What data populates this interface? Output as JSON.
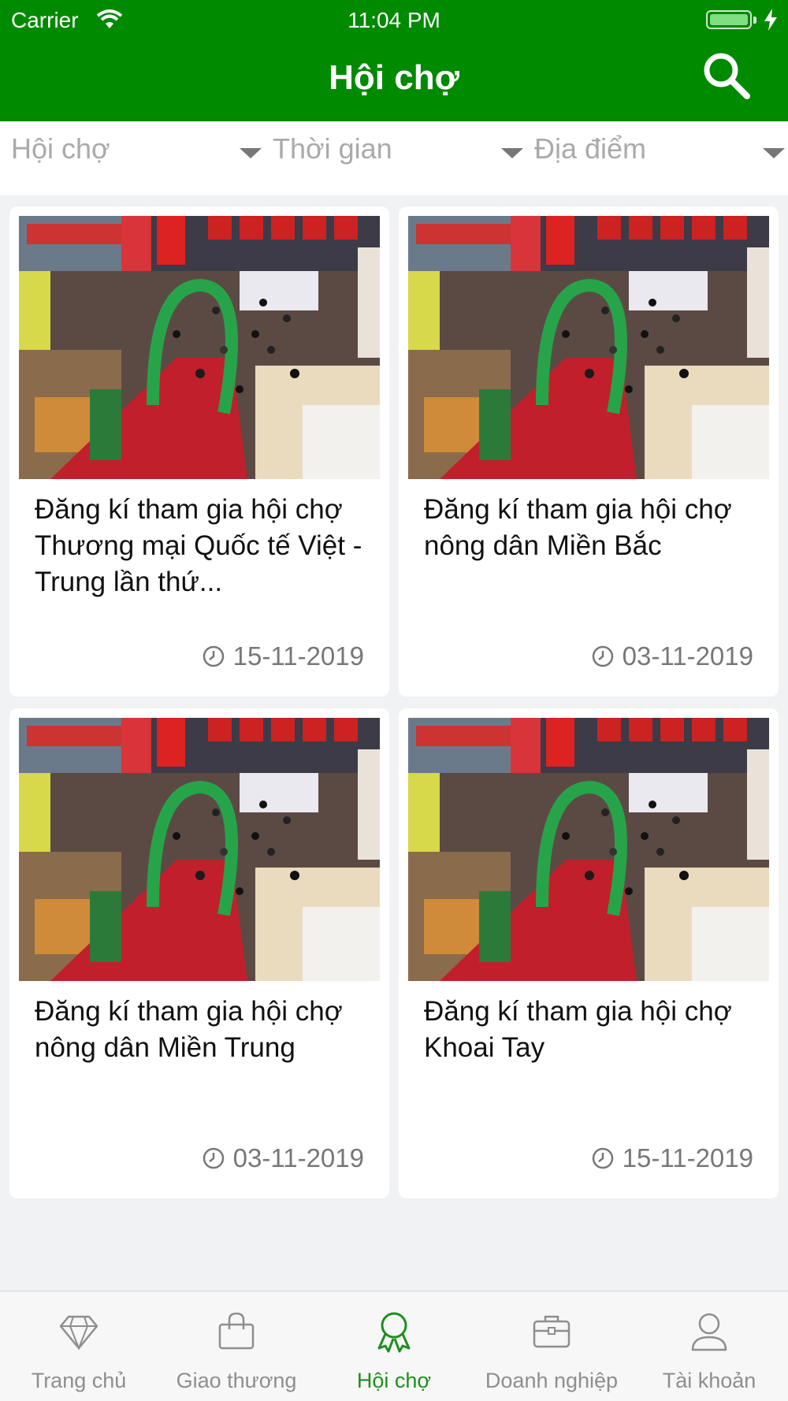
{
  "status_bar": {
    "carrier": "Carrier",
    "time": "11:04 PM"
  },
  "header": {
    "title": "Hội chợ"
  },
  "filters": [
    {
      "label": "Hội chợ"
    },
    {
      "label": "Thời gian"
    },
    {
      "label": "Địa điểm"
    }
  ],
  "events": [
    {
      "title": "Đăng kí tham gia hội chợ Thương mại Quốc tế Việt - Trung lần thứ...",
      "date": "15-11-2019"
    },
    {
      "title": "Đăng kí tham gia hội chợ nông dân Miền Bắc",
      "date": "03-11-2019"
    },
    {
      "title": "Đăng kí tham gia hội chợ nông dân Miền Trung",
      "date": "03-11-2019"
    },
    {
      "title": "Đăng kí tham gia hội chợ Khoai Tay",
      "date": "15-11-2019"
    }
  ],
  "tabs": [
    {
      "label": "Trang chủ",
      "icon": "diamond-icon",
      "active": false
    },
    {
      "label": "Giao thương",
      "icon": "shopping-bag-icon",
      "active": false
    },
    {
      "label": "Hội chợ",
      "icon": "award-icon",
      "active": true
    },
    {
      "label": "Doanh nghiệp",
      "icon": "briefcase-icon",
      "active": false
    },
    {
      "label": "Tài khoản",
      "icon": "user-icon",
      "active": false
    }
  ],
  "colors": {
    "primary": "#008a00",
    "active_tab": "#1e8f1e",
    "inactive": "#8e8e8e"
  }
}
